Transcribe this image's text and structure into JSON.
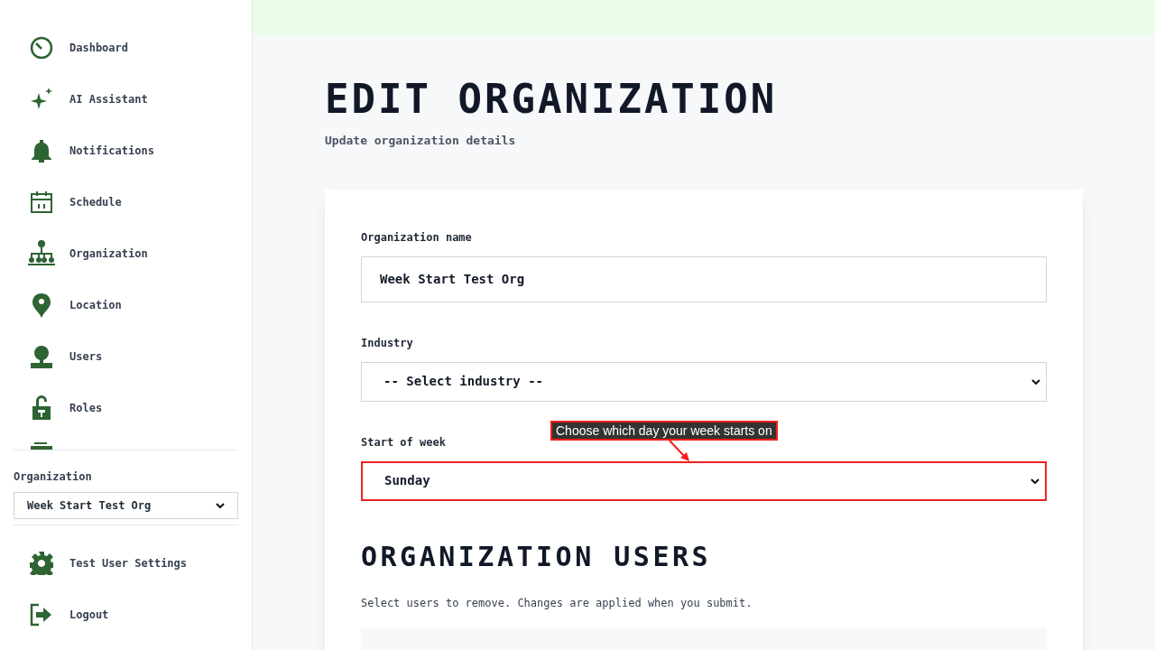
{
  "sidebar": {
    "nav_items": [
      {
        "label": "Dashboard"
      },
      {
        "label": "AI Assistant"
      },
      {
        "label": "Notifications"
      },
      {
        "label": "Schedule"
      },
      {
        "label": "Organization"
      },
      {
        "label": "Location"
      },
      {
        "label": "Users"
      },
      {
        "label": "Roles"
      }
    ],
    "org_switcher": {
      "label": "Organization",
      "value": "Week Start Test Org"
    },
    "footer_items": [
      {
        "label": "Test User Settings"
      },
      {
        "label": "Logout"
      }
    ]
  },
  "page": {
    "title": "EDIT ORGANIZATION",
    "subtitle": "Update organization details"
  },
  "form": {
    "fields": [
      {
        "label": "Organization name",
        "kind": "text",
        "value": "Week Start Test Org",
        "highlighted": false
      },
      {
        "label": "Industry",
        "kind": "select",
        "value": "-- Select industry --",
        "highlighted": false
      },
      {
        "label": "Start of week",
        "kind": "select",
        "value": "Sunday",
        "highlighted": true
      }
    ]
  },
  "annotation": {
    "text": "Choose which day your week starts on"
  },
  "users_section": {
    "title": "ORGANIZATION USERS",
    "description": "Select users to remove. Changes are applied when you submit."
  }
}
